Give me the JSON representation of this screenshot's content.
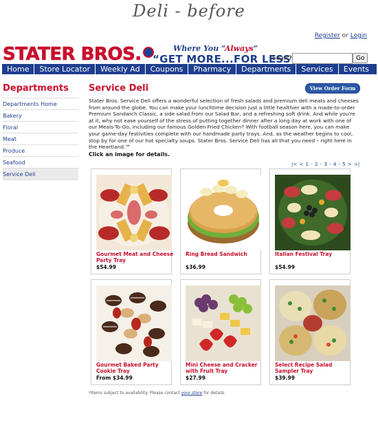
{
  "page_heading": "Deli - before",
  "account": {
    "register": "Register",
    "or": "or",
    "login": "Login"
  },
  "header": {
    "logo": "STATER BROS.",
    "tagline_1_a": "Where You “",
    "tagline_1_b": "Always",
    "tagline_1_c": "”",
    "tagline_2": "“GET MORE...FOR LESS”",
    "search_label": "Search:",
    "search_value": "",
    "go_label": "Go"
  },
  "nav": [
    "Home",
    "Store Locator",
    "Weekly Ad",
    "Coupons",
    "Pharmacy",
    "Departments",
    "Services",
    "Events"
  ],
  "sidebar": {
    "title": "Departments",
    "items": [
      "Departments Home",
      "Bakery",
      "Floral",
      "Meat",
      "Produce",
      "Seafood",
      "Service Deli"
    ]
  },
  "main": {
    "title": "Service Deli",
    "order_button": "View Order Form",
    "intro": "Stater Bros. Service Deli offers a wonderful selection of fresh salads and premium deli meats and cheeses from around the globe. You can make your lunchtime decision just a little healthier with a made-to-order Premium Sandwich Classic, a side salad from our Salad Bar, and a refreshing soft drink. And while you're at it, why not ease yourself of the stress of putting together dinner after a long day at work with one of our Meals-To-Go, including our famous Golden Fried Chicken? With football season here, you can make your game-day festivities complete with our handmade party trays. And, as the weather begins to cool, stop by for one of our hot specialty soups. Stater Bros. Service Deli has all that you need – right here in the Heartland.℠",
    "click_note": "Click an image for details.",
    "pager": "|< < 1 - 2 - 3 - 4 - 5 > >|"
  },
  "products": [
    {
      "name": "Gourmet Meat and Cheese Party Tray",
      "price": "$54.99",
      "image": "meat-cheese-tray-image"
    },
    {
      "name": "Ring Bread Sandwich",
      "price": "$36.99",
      "image": "ring-bread-sandwich-image"
    },
    {
      "name": "Italian Festival Tray",
      "price": "$54.99",
      "image": "italian-festival-tray-image"
    },
    {
      "name": "Gourmet Baked Party Cookie Tray",
      "price": "From $34.99",
      "image": "cookie-tray-image"
    },
    {
      "name": "Mini Cheese and Cracker with Fruit Tray",
      "price": "$27.99",
      "image": "cheese-fruit-tray-image"
    },
    {
      "name": "Select Recipe Salad Sampler Tray",
      "price": "$39.99",
      "image": "salad-sampler-tray-image"
    }
  ],
  "footnote": {
    "text": "*Items subject to availability. Please contact",
    "link": "your store",
    "end": "for details."
  },
  "colors": {
    "brand_red": "#c8102e",
    "brand_blue": "#1e3f8f"
  }
}
